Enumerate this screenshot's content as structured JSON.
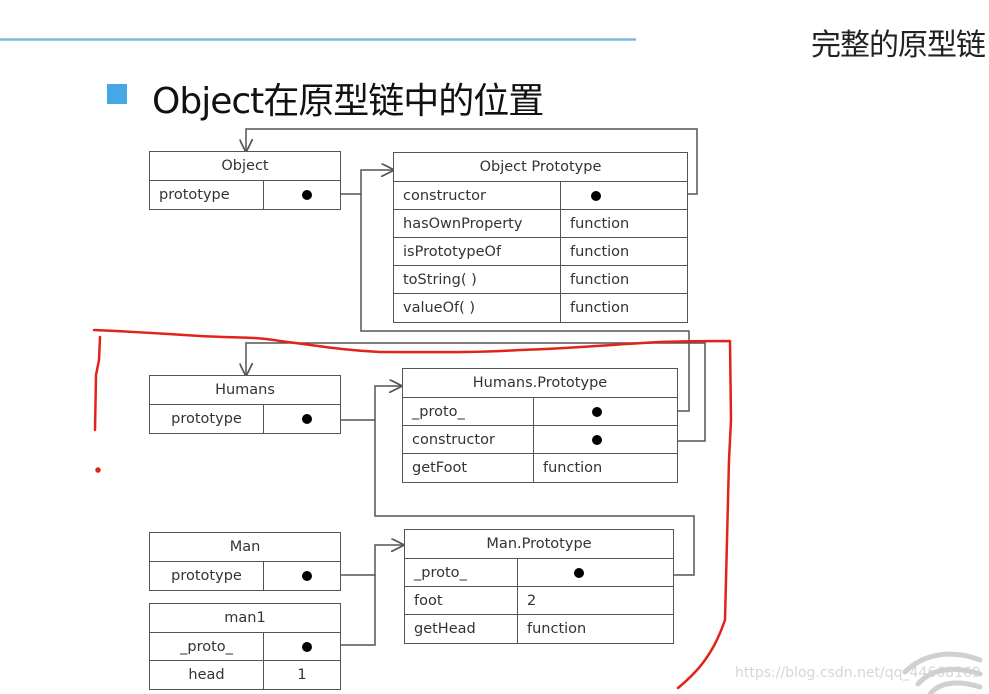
{
  "slide": {
    "corner_title": "完整的原型链",
    "heading": "Object在原型链中的位置",
    "accent_color": "#45a8e4",
    "annotation_color": "#e2231a"
  },
  "boxes": {
    "object": {
      "title": "Object",
      "rows": [
        {
          "key": "prototype",
          "value": "",
          "pointer": true
        }
      ]
    },
    "object_prototype": {
      "title": "Object Prototype",
      "rows": [
        {
          "key": "constructor",
          "value": "",
          "pointer": true
        },
        {
          "key": "hasOwnProperty",
          "value": "function"
        },
        {
          "key": "isPrototypeOf",
          "value": "function"
        },
        {
          "key": "toString( )",
          "value": "function"
        },
        {
          "key": "valueOf( )",
          "value": "function"
        }
      ]
    },
    "humans": {
      "title": "Humans",
      "rows": [
        {
          "key": "prototype",
          "value": "",
          "pointer": true
        }
      ]
    },
    "humans_prototype": {
      "title": "Humans.Prototype",
      "rows": [
        {
          "key": "_proto_",
          "value": "",
          "pointer": true
        },
        {
          "key": "constructor",
          "value": "",
          "pointer": true
        },
        {
          "key": "getFoot",
          "value": "function"
        }
      ]
    },
    "man": {
      "title": "Man",
      "rows": [
        {
          "key": "prototype",
          "value": "",
          "pointer": true
        }
      ]
    },
    "man_prototype": {
      "title": "Man.Prototype",
      "rows": [
        {
          "key": "_proto_",
          "value": "",
          "pointer": true
        },
        {
          "key": "foot",
          "value": "2"
        },
        {
          "key": "getHead",
          "value": "function"
        }
      ]
    },
    "man1": {
      "title": "man1",
      "rows": [
        {
          "key": "_proto_",
          "value": "",
          "pointer": true
        },
        {
          "key": "head",
          "value": "1"
        }
      ]
    }
  },
  "links": [
    {
      "from": "Object.prototype",
      "to": "Object Prototype"
    },
    {
      "from": "Object Prototype.constructor",
      "to": "Object"
    },
    {
      "from": "Humans.prototype",
      "to": "Humans.Prototype"
    },
    {
      "from": "Humans.Prototype._proto_",
      "to": "Object Prototype"
    },
    {
      "from": "Humans.Prototype.constructor",
      "to": "Humans"
    },
    {
      "from": "Man.prototype",
      "to": "Man.Prototype"
    },
    {
      "from": "man1._proto_",
      "to": "Man.Prototype"
    },
    {
      "from": "Man.Prototype._proto_",
      "to": "Humans.Prototype"
    }
  ],
  "watermark": "https://blog.csdn.net/qq_44668169"
}
